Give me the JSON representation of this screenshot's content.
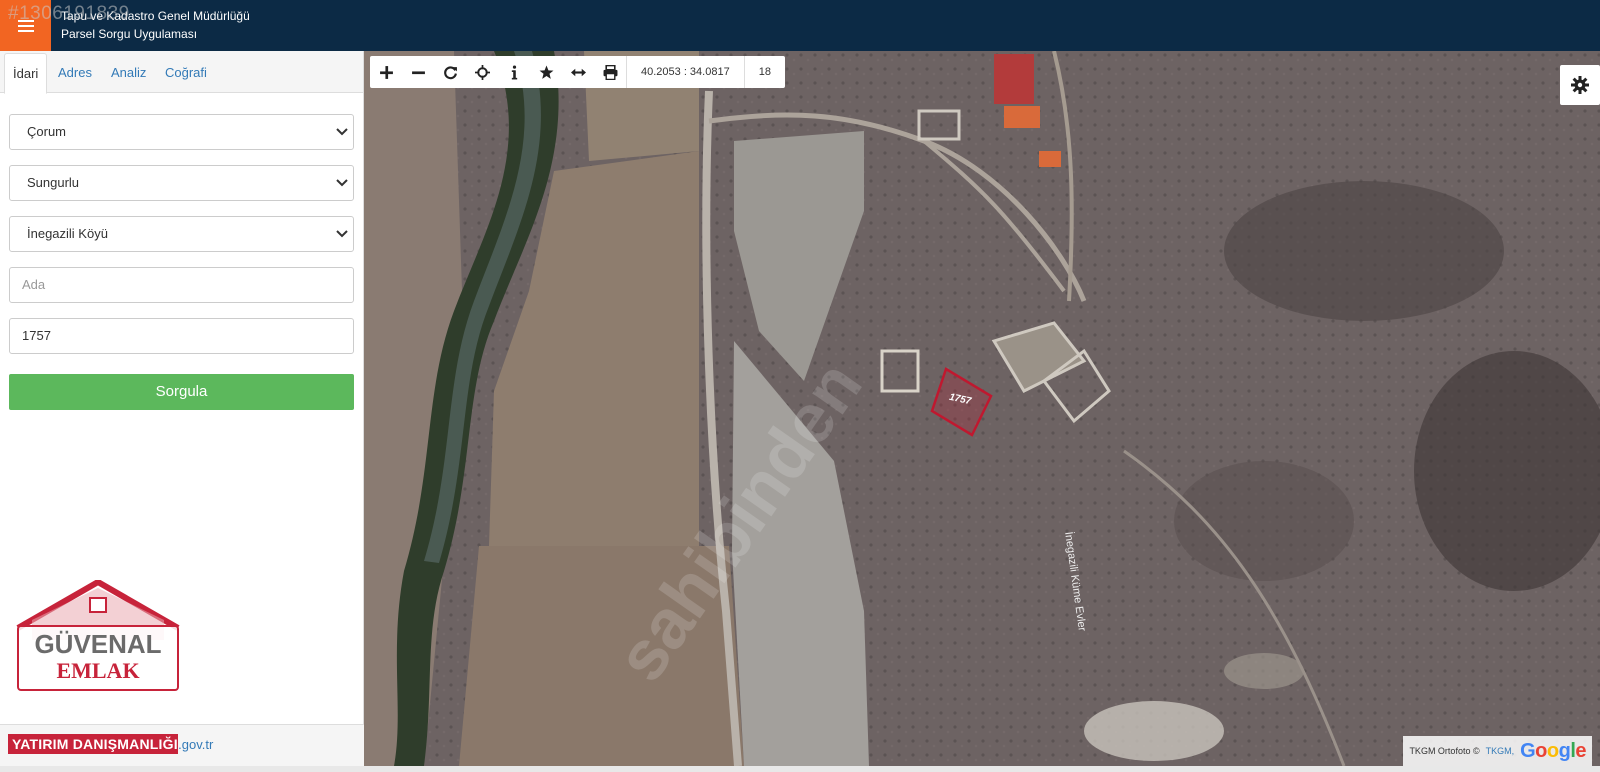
{
  "header": {
    "ad_id": "#1306191839",
    "title_line1": "Tapu ve Kadastro Genel Müdürlüğü",
    "title_line2": "Parsel Sorgu Uygulaması"
  },
  "tabs": [
    {
      "label": "İdari",
      "active": true
    },
    {
      "label": "Adres"
    },
    {
      "label": "Analiz"
    },
    {
      "label": "Coğrafi"
    }
  ],
  "form": {
    "il": "Çorum",
    "ilce": "Sungurlu",
    "mahalle": "İnegazili Köyü",
    "ada_placeholder": "Ada",
    "parsel": "1757",
    "submit_label": "Sorgula"
  },
  "footer": {
    "link": "tkgm.gov.tr"
  },
  "logo": {
    "line1": "GÜVENAL",
    "line2": "EMLAK",
    "band": "YATIRIM DANIŞMANLIĞI"
  },
  "map": {
    "coordinates": "40.2053 : 34.0817",
    "zoom": "18",
    "road_label": "İnegazili Küme Evler",
    "parcel_label": "1757",
    "watermark": "sahibinden",
    "attribution_text": "TKGM Ortofoto ©",
    "attribution_link": "TKGM,",
    "google": "Google"
  },
  "toolbar_icons": [
    "zoom-in-icon",
    "zoom-out-icon",
    "refresh-icon",
    "locate-icon",
    "info-icon",
    "star-icon",
    "measure-icon",
    "print-icon"
  ],
  "colors": {
    "header_bg": "#0c2a45",
    "menu_accent": "#f26522",
    "submit_green": "#5cb85c",
    "parcel_outline": "#c0182f"
  }
}
